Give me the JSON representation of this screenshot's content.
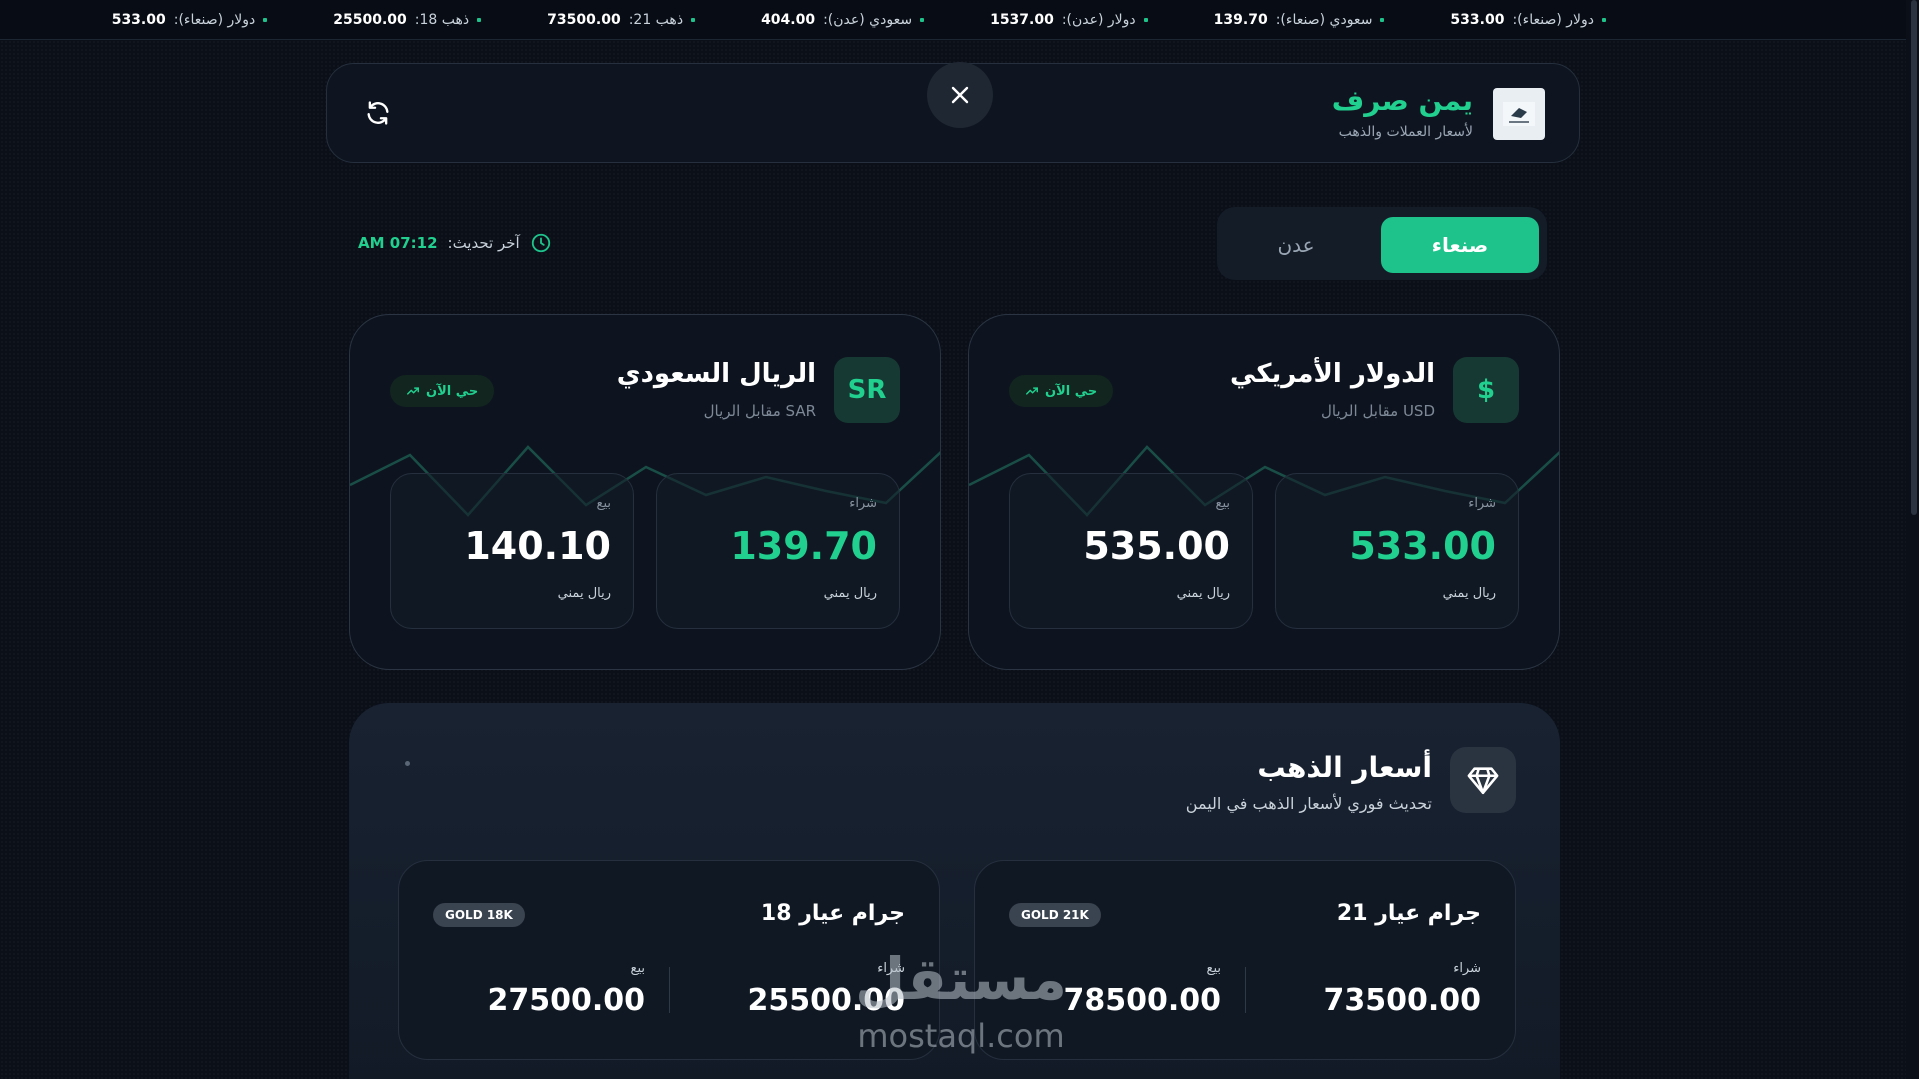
{
  "ticker": [
    {
      "label": "دولار (صنعاء):",
      "value": "533.00"
    },
    {
      "label": "سعودي (صنعاء):",
      "value": "139.70"
    },
    {
      "label": "دولار (عدن):",
      "value": "1537.00"
    },
    {
      "label": "سعودي (عدن):",
      "value": "404.00"
    },
    {
      "label": "ذهب 21:",
      "value": "73500.00"
    },
    {
      "label": "ذهب 18:",
      "value": "25500.00"
    },
    {
      "label": "دولار (صنعاء):",
      "value": "533.00"
    }
  ],
  "header": {
    "brand_title": "يمن صرف",
    "brand_sub": "لأسعار العملات والذهب",
    "logo_icon": "logo-icon",
    "close_icon": "close-icon",
    "refresh_icon": "refresh-icon"
  },
  "cities": {
    "active": "صنعاء",
    "inactive": "عدن"
  },
  "last_update": {
    "label": "آخر تحديث:",
    "time": "AM 07:12"
  },
  "currencies": {
    "usd": {
      "icon_text": "$",
      "title": "الدولار الأمريكي",
      "subtitle": "USD مقابل الريال",
      "live": "حي الآن",
      "buy_label": "شراء",
      "buy_value": "533.00",
      "sell_label": "بيع",
      "sell_value": "535.00",
      "unit": "ريال يمني"
    },
    "sar": {
      "icon_text": "SR",
      "title": "الريال السعودي",
      "subtitle": "SAR مقابل الريال",
      "live": "حي الآن",
      "buy_label": "شراء",
      "buy_value": "139.70",
      "sell_label": "بيع",
      "sell_value": "140.10",
      "unit": "ريال يمني"
    }
  },
  "gold": {
    "title": "أسعار الذهب",
    "subtitle": "تحديث فوري لأسعار الذهب في اليمن",
    "icon": "diamond-icon",
    "k21": {
      "title": "جرام عيار 21",
      "badge": "GOLD 21K",
      "buy_label": "شراء",
      "buy_value": "73500.00",
      "sell_label": "بيع",
      "sell_value": "78500.00"
    },
    "k18": {
      "title": "جرام عيار 18",
      "badge": "GOLD 18K",
      "buy_label": "شراء",
      "buy_value": "25500.00",
      "sell_label": "بيع",
      "sell_value": "27500.00"
    }
  },
  "watermark": {
    "ar": "مستقل",
    "en": "mostaql.com"
  },
  "colors": {
    "accent": "#1ec28b",
    "accent_text": "#21d08f",
    "background": "#0a0f18"
  }
}
